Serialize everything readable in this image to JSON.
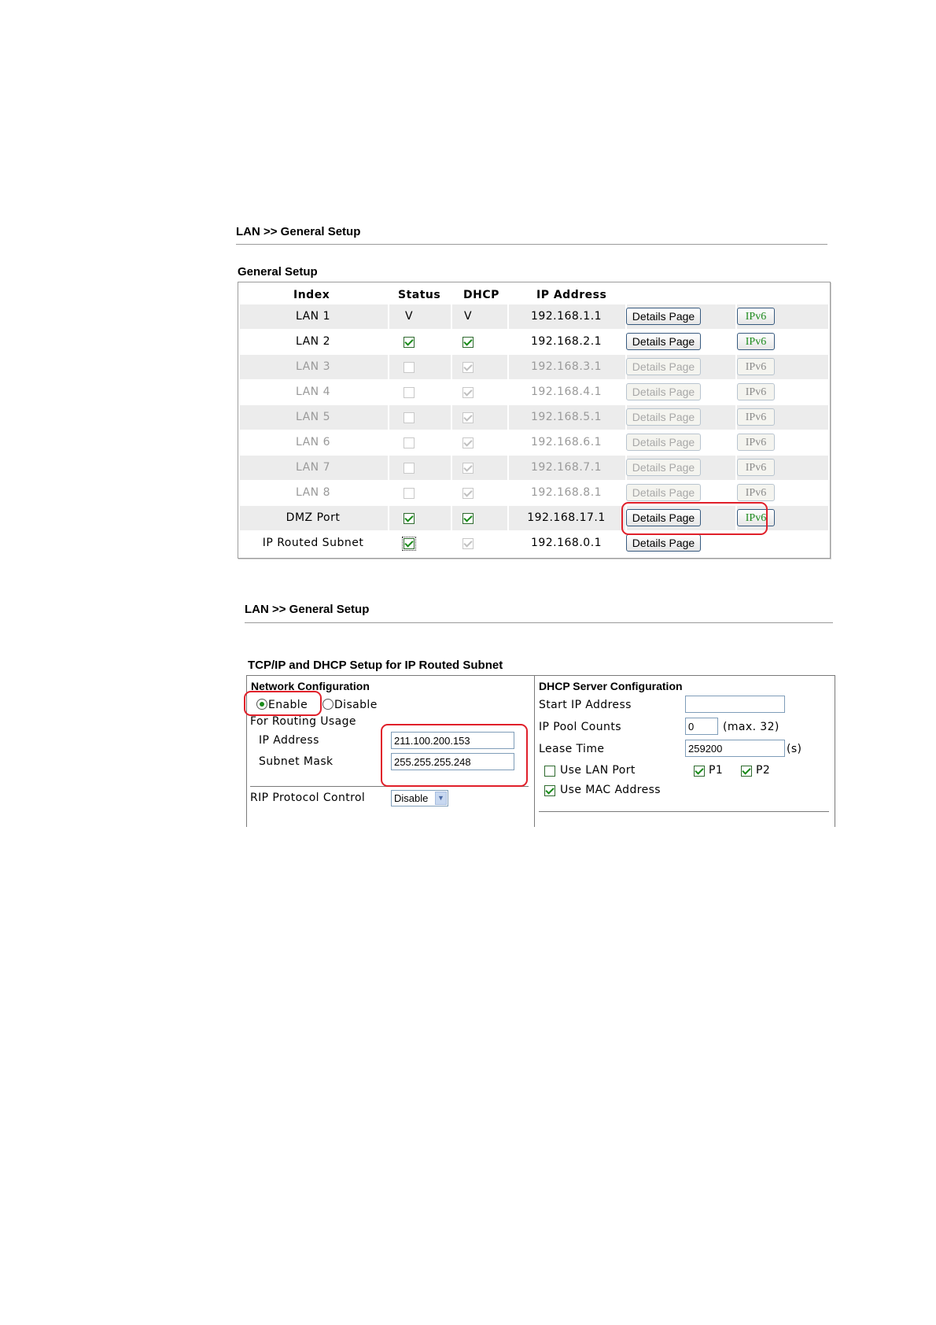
{
  "general": {
    "breadcrumb": "LAN >> General Setup",
    "section_title": "General Setup",
    "columns": {
      "index": "Index",
      "status": "Status",
      "dhcp": "DHCP",
      "ip": "IP Address"
    },
    "details_label": "Details Page",
    "ipv6_label": "IPv6",
    "rows": [
      {
        "index": "LAN 1",
        "status": "V",
        "dhcp": "V",
        "ip": "192.168.1.1",
        "enabled": true,
        "status_type": "text",
        "dhcp_type": "text",
        "ipv6": true
      },
      {
        "index": "LAN 2",
        "status": "checked",
        "dhcp": "checked",
        "ip": "192.168.2.1",
        "enabled": true,
        "ipv6": true
      },
      {
        "index": "LAN 3",
        "status": "unchecked",
        "dhcp": "checked",
        "ip": "192.168.3.1",
        "enabled": false,
        "ipv6": true
      },
      {
        "index": "LAN 4",
        "status": "unchecked",
        "dhcp": "checked",
        "ip": "192.168.4.1",
        "enabled": false,
        "ipv6": true
      },
      {
        "index": "LAN 5",
        "status": "unchecked",
        "dhcp": "checked",
        "ip": "192.168.5.1",
        "enabled": false,
        "ipv6": true
      },
      {
        "index": "LAN 6",
        "status": "unchecked",
        "dhcp": "checked",
        "ip": "192.168.6.1",
        "enabled": false,
        "ipv6": true
      },
      {
        "index": "LAN 7",
        "status": "unchecked",
        "dhcp": "checked",
        "ip": "192.168.7.1",
        "enabled": false,
        "ipv6": true
      },
      {
        "index": "LAN 8",
        "status": "unchecked",
        "dhcp": "checked",
        "ip": "192.168.8.1",
        "enabled": false,
        "ipv6": true
      },
      {
        "index": "DMZ Port",
        "status": "checked",
        "dhcp": "checked",
        "ip": "192.168.17.1",
        "enabled": true,
        "ipv6": true
      },
      {
        "index": "IP Routed Subnet",
        "status": "checked",
        "dhcp": "checked",
        "ip": "192.168.0.1",
        "enabled": true,
        "ipv6": false
      }
    ]
  },
  "tcpip": {
    "breadcrumb": "LAN >> General Setup",
    "section_title": "TCP/IP and DHCP Setup for IP Routed Subnet",
    "network": {
      "title": "Network Configuration",
      "enable_label": "Enable",
      "disable_label": "Disable",
      "selected": "Enable",
      "routing_usage_label": "For Routing Usage",
      "ip_label": "IP Address",
      "ip_value": "211.100.200.153",
      "mask_label": "Subnet Mask",
      "mask_value": "255.255.255.248",
      "rip_label": "RIP Protocol Control",
      "rip_value": "Disable"
    },
    "dhcp": {
      "title": "DHCP Server Configuration",
      "start_ip_label": "Start IP Address",
      "start_ip_value": "",
      "pool_label": "IP Pool Counts",
      "pool_value": "0",
      "pool_hint": "(max. 32)",
      "lease_label": "Lease Time",
      "lease_value": "259200",
      "lease_unit": "(s)",
      "use_lan_port_label": "Use LAN Port",
      "p1_label": "P1",
      "p2_label": "P2",
      "use_mac_label": "Use MAC Address"
    }
  },
  "colors": {
    "highlight": "#e0202a",
    "check": "#188a18"
  }
}
